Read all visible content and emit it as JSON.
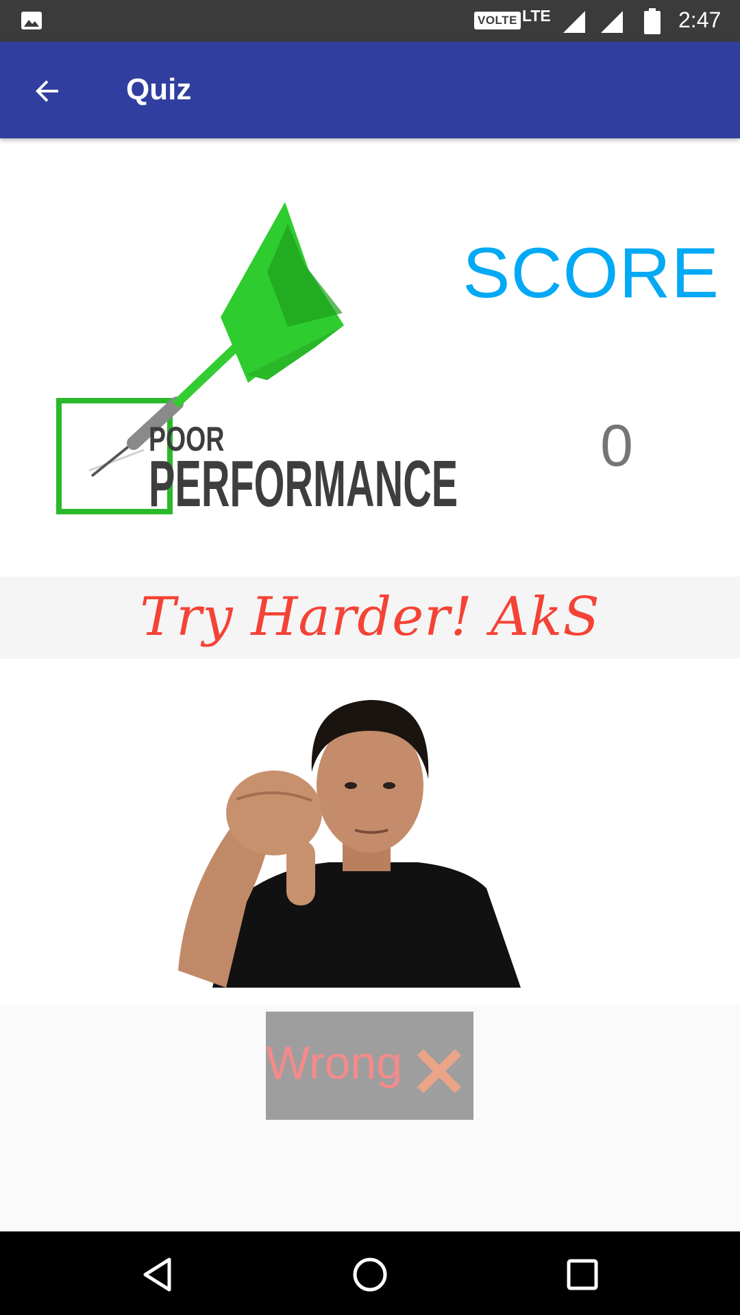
{
  "status_bar": {
    "volte": "VOLTE",
    "network": "LTE",
    "time": "2:47",
    "icons": [
      "image-icon",
      "signal-icon",
      "signal-icon",
      "battery-icon"
    ]
  },
  "app_bar": {
    "title": "Quiz",
    "back_icon": "arrow-back-icon",
    "color": "#303f9f"
  },
  "hero": {
    "logo_line1": "POOR",
    "logo_line2": "PERFORMANCE",
    "score_label": "SCORE",
    "score_value": "0",
    "score_label_color": "#03a9f4"
  },
  "message": {
    "text": "Try Harder! AkS",
    "color": "#f44336"
  },
  "result_button": {
    "label": "Wrong",
    "icon": "cross-icon"
  },
  "nav_bar": {
    "icons": [
      "back-triangle-icon",
      "home-circle-icon",
      "recents-square-icon"
    ]
  }
}
